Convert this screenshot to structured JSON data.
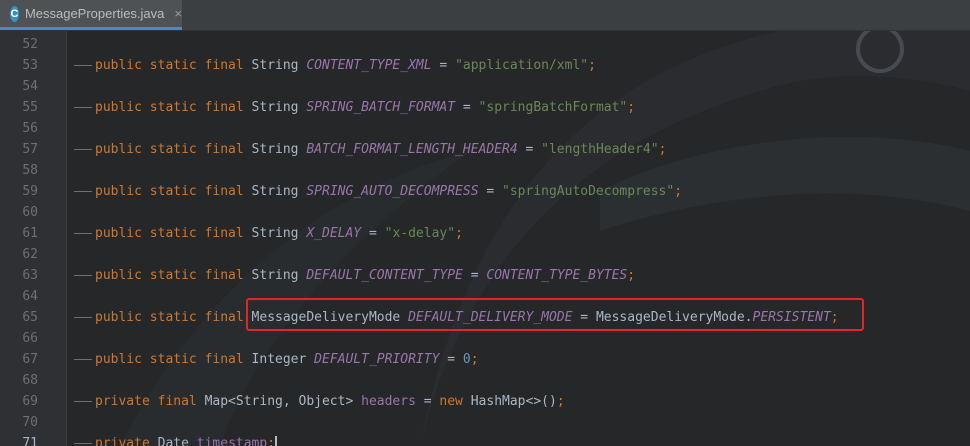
{
  "tab": {
    "filename": "MessageProperties.java",
    "icon": "java-class-icon",
    "icon_letter": "C",
    "close": "×"
  },
  "lines": [
    {
      "num": "52"
    },
    {
      "num": "53",
      "kw": "public static final",
      "type": "String",
      "name": "CONTENT_TYPE_XML",
      "eq": " = ",
      "val": "\"application/xml\"",
      "end": ";"
    },
    {
      "num": "54"
    },
    {
      "num": "55",
      "kw": "public static final",
      "type": "String",
      "name": "SPRING_BATCH_FORMAT",
      "eq": " = ",
      "val": "\"springBatchFormat\"",
      "end": ";"
    },
    {
      "num": "56"
    },
    {
      "num": "57",
      "kw": "public static final",
      "type": "String",
      "name": "BATCH_FORMAT_LENGTH_HEADER4",
      "eq": " = ",
      "val": "\"lengthHeader4\"",
      "end": ";"
    },
    {
      "num": "58"
    },
    {
      "num": "59",
      "kw": "public static final",
      "type": "String",
      "name": "SPRING_AUTO_DECOMPRESS",
      "eq": " = ",
      "val": "\"springAutoDecompress\"",
      "end": ";"
    },
    {
      "num": "60"
    },
    {
      "num": "61",
      "kw": "public static final",
      "type": "String",
      "name": "X_DELAY",
      "eq": " = ",
      "val": "\"x-delay\"",
      "end": ";"
    },
    {
      "num": "62"
    },
    {
      "num": "63",
      "kw": "public static final",
      "type": "String",
      "name": "DEFAULT_CONTENT_TYPE",
      "eq": " = ",
      "val": "CONTENT_TYPE_BYTES",
      "end": ";"
    },
    {
      "num": "64"
    },
    {
      "num": "65",
      "kw": "public static final",
      "type": "MessageDeliveryMode",
      "name": "DEFAULT_DELIVERY_MODE",
      "eq": " = ",
      "val_prefix": "MessageDeliveryMode.",
      "val": "PERSISTENT",
      "end": ";"
    },
    {
      "num": "66"
    },
    {
      "num": "67",
      "kw": "public static final",
      "type": "Integer",
      "name": "DEFAULT_PRIORITY",
      "eq": " = ",
      "val": "0",
      "end": ";"
    },
    {
      "num": "68"
    },
    {
      "num": "69",
      "kw": "private final",
      "type": "Map<String, Object>",
      "name": "headers",
      "eq": " = ",
      "kw2": "new",
      "val": " HashMap<>()",
      "end": ";"
    },
    {
      "num": "70"
    },
    {
      "num": "71",
      "kw": "private",
      "type": "Date",
      "name": "timestamp",
      "end": ";"
    }
  ],
  "highlight_color": "#e0262b"
}
